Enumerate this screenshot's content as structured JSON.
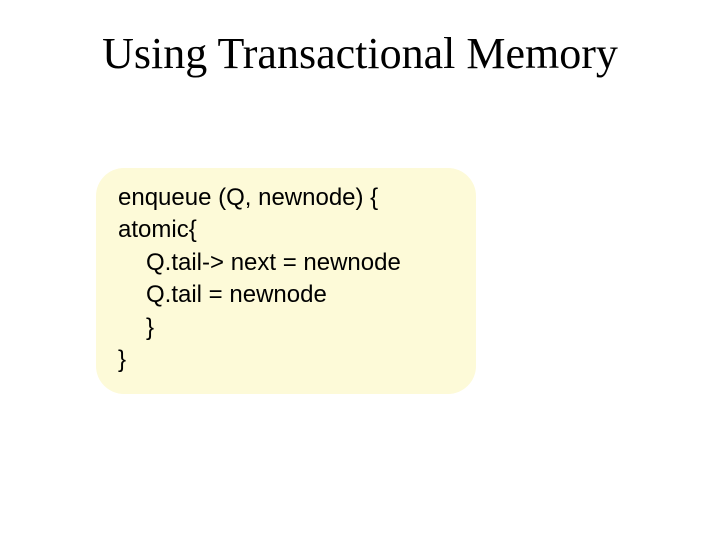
{
  "title": "Using Transactional Memory",
  "code": {
    "l1": "enqueue (Q, newnode) {",
    "l2": "atomic{",
    "l3": "Q.tail-> next = newnode",
    "l4": "Q.tail = newnode",
    "l5": "}",
    "l6": "}"
  }
}
